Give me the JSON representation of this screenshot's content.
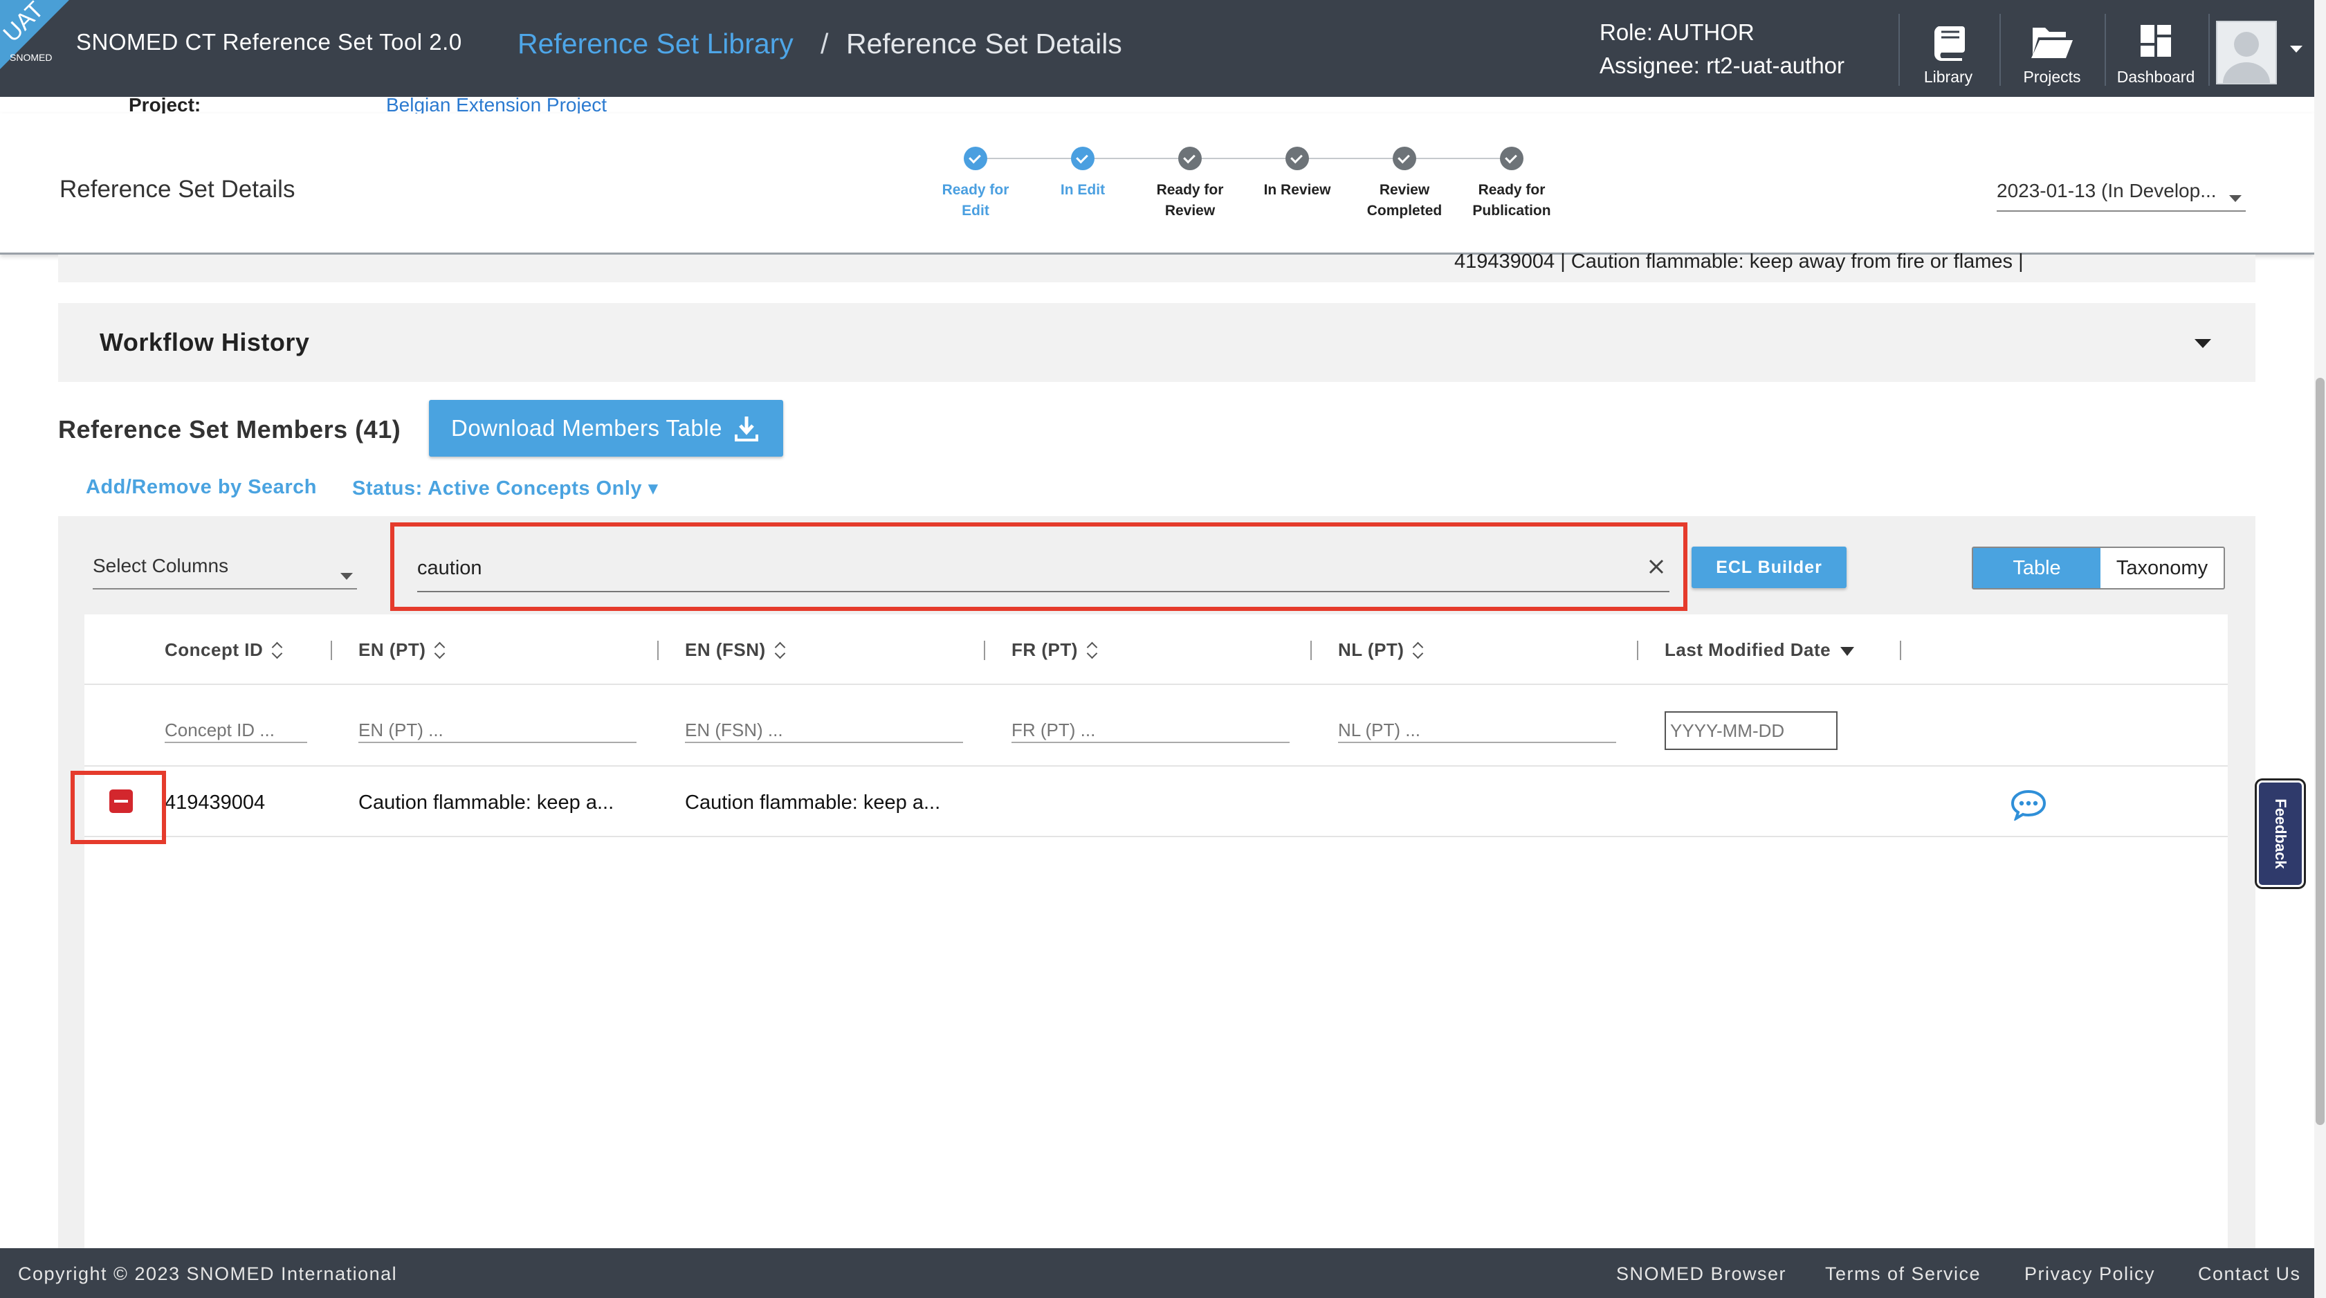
{
  "header": {
    "logo_badge": "UAT",
    "logo_text": "SNOMED",
    "app_title": "SNOMED CT Reference Set Tool 2.0",
    "breadcrumb": {
      "link": "Reference Set Library",
      "separator": "/",
      "current": "Reference Set Details"
    },
    "role": "Role: AUTHOR",
    "assignee": "Assignee: rt2-uat-author",
    "nav": [
      {
        "label": "Library",
        "icon": "book-icon"
      },
      {
        "label": "Projects",
        "icon": "folder-open-icon"
      },
      {
        "label": "Dashboard",
        "icon": "dashboard-grid-icon"
      }
    ],
    "avatar_icon": "user-avatar-icon"
  },
  "project_peek": {
    "label": "Project:",
    "value": "Belgian Extension Project"
  },
  "sub_header": {
    "title": "Reference Set Details",
    "steps": [
      {
        "label_1": "Ready for",
        "label_2": "Edit",
        "state": "done"
      },
      {
        "label_1": "In Edit",
        "label_2": "",
        "state": "done"
      },
      {
        "label_1": "Ready for",
        "label_2": "Review",
        "state": "todo"
      },
      {
        "label_1": "In Review",
        "label_2": "",
        "state": "todo"
      },
      {
        "label_1": "Review",
        "label_2": "Completed",
        "state": "todo"
      },
      {
        "label_1": "Ready for",
        "label_2": "Publication",
        "state": "todo"
      }
    ],
    "version_select": "2023-01-13 (In Develop..."
  },
  "peek_text": "419439004 | Caution flammable: keep away from fire or flames |",
  "workflow_history": {
    "title": "Workflow History"
  },
  "members": {
    "title": "Reference Set Members (41)",
    "download_label": "Download Members Table",
    "add_remove_link": "Add/Remove by Search",
    "status_link": "Status: Active Concepts Only ▾",
    "select_columns": "Select Columns",
    "search_value": "caution",
    "ecl_builder": "ECL Builder",
    "view_toggle": {
      "table": "Table",
      "taxonomy": "Taxonomy",
      "active": "Table"
    }
  },
  "table": {
    "columns": [
      {
        "label": "Concept ID",
        "filter": "Concept ID ..."
      },
      {
        "label": "EN (PT)",
        "filter": "EN (PT) ..."
      },
      {
        "label": "EN (FSN)",
        "filter": "EN (FSN) ..."
      },
      {
        "label": "FR (PT)",
        "filter": "FR (PT) ..."
      },
      {
        "label": "NL (PT)",
        "filter": "NL (PT) ..."
      },
      {
        "label": "Last Modified Date",
        "filter": "YYYY-MM-DD"
      }
    ],
    "rows": [
      {
        "concept_id": "419439004",
        "en_pt": "Caution flammable: keep a...",
        "en_fsn": "Caution flammable: keep a...",
        "fr_pt": "",
        "nl_pt": "",
        "last_modified": ""
      }
    ]
  },
  "feedback": "Feedback",
  "footer": {
    "copyright": "Copyright © 2023 SNOMED International",
    "links": [
      "SNOMED Browser",
      "Terms of Service",
      "Privacy Policy",
      "Contact Us"
    ]
  },
  "colors": {
    "accent": "#4aa3e0",
    "header_bg": "#3a414b",
    "remove_red": "#d3272d",
    "highlight": "#e53b2c"
  }
}
